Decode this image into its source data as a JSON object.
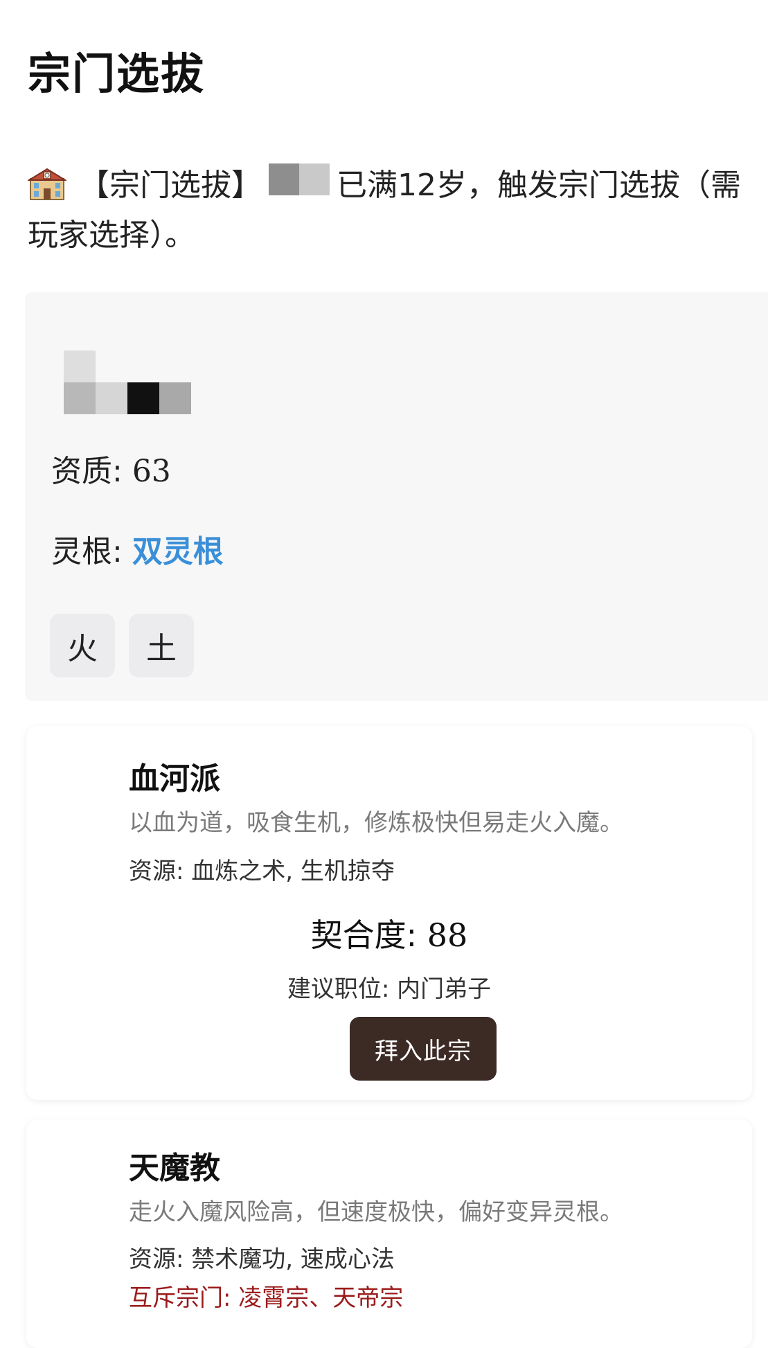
{
  "page": {
    "title": "宗门选拔"
  },
  "event": {
    "icon": "school-building-icon",
    "tag": "【宗门选拔】",
    "message": "已满12岁，触发宗门选拔（需玩家选择）。"
  },
  "profile": {
    "aptitude_label": "资质",
    "aptitude_value": "63",
    "root_label": "灵根",
    "root_value": "双灵根",
    "root_color": "#3a8fd8",
    "elements": [
      "火",
      "土"
    ]
  },
  "sects": [
    {
      "name": "血河派",
      "description": "以血为道，吸食生机，修炼极快但易走火入魔。",
      "resources_label": "资源",
      "resources": "血炼之术, 生机掠夺",
      "match_label": "契合度",
      "match_value": "88",
      "role_label": "建议职位",
      "role_value": "内门弟子",
      "join_label": "拜入此宗"
    },
    {
      "name": "天魔教",
      "description": "走火入魔风险高，但速度极快，偏好变异灵根。",
      "resources_label": "资源",
      "resources": "禁术魔功, 速成心法",
      "exclusive_label": "互斥宗门",
      "exclusive": "凌霄宗、天帝宗"
    }
  ],
  "colors": {
    "button_bg": "#3c2a25",
    "exclusive_text": "#9b1c1c",
    "card_bg": "#f7f7f8"
  }
}
